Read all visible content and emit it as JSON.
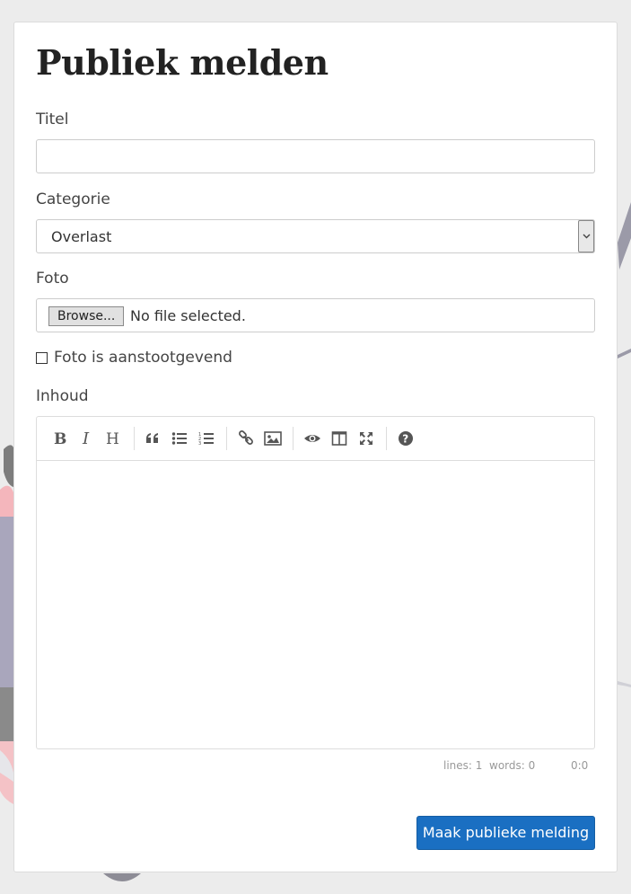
{
  "page": {
    "title": "Publiek melden"
  },
  "form": {
    "title_label": "Titel",
    "title_value": "",
    "category_label": "Categorie",
    "category_value": "Overlast",
    "photo_label": "Foto",
    "browse_label": "Browse...",
    "file_status": "No file selected.",
    "offensive_checkbox_label": "Foto is aanstootgevend",
    "offensive_checked": false,
    "content_label": "Inhoud",
    "submit_label": "Maak publieke melding"
  },
  "editor": {
    "toolbar": [
      {
        "name": "bold-icon",
        "glyph": "B"
      },
      {
        "name": "italic-icon",
        "glyph": "I"
      },
      {
        "name": "heading-icon",
        "glyph": "H"
      },
      {
        "name": "quote-icon",
        "glyph": "quote"
      },
      {
        "name": "unordered-list-icon",
        "glyph": "ul"
      },
      {
        "name": "ordered-list-icon",
        "glyph": "ol"
      },
      {
        "name": "link-icon",
        "glyph": "link"
      },
      {
        "name": "image-icon",
        "glyph": "image"
      },
      {
        "name": "preview-icon",
        "glyph": "eye"
      },
      {
        "name": "side-by-side-icon",
        "glyph": "columns"
      },
      {
        "name": "fullscreen-icon",
        "glyph": "expand"
      },
      {
        "name": "guide-icon",
        "glyph": "question"
      }
    ],
    "status": {
      "lines": "lines: 1",
      "words": "words: 0",
      "cursor": "0:0"
    }
  },
  "colors": {
    "primary_button": "#1a6fc2",
    "background": "#ececec",
    "toolbar_icon": "#555555"
  }
}
